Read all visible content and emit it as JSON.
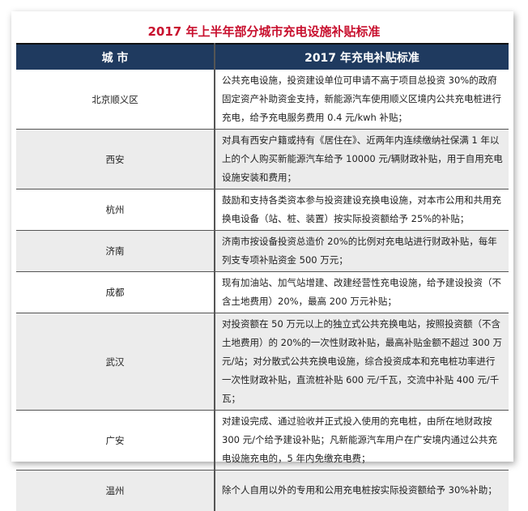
{
  "title": "2017 年上半年部分城市充电设施补贴标准",
  "headers": {
    "city": "城 市",
    "standard": "2017 年充电补贴标准"
  },
  "rows": [
    {
      "city": "北京顺义区",
      "standard": "公共充电设施，投资建设单位可申请不高于项目总投资 30%的政府固定资产补助资金支持，新能源汽车使用顺义区境内公共充电桩进行充电，给予充电服务费用 0.4 元/kwh 补贴；"
    },
    {
      "city": "西安",
      "standard": "对具有西安户籍或持有《居住在》、近两年内连续缴纳社保满 1 年以上的个人购买新能源汽车给予 10000 元/辆财政补贴，用于自用充电设施安装和费用；"
    },
    {
      "city": "杭州",
      "standard": "鼓励和支持各类资本参与投资建设充换电设施，对本市公用和共用充换电设备（站、桩、装置）按实际投资额给予 25%的补贴；"
    },
    {
      "city": "济南",
      "standard": "济南市按设备投资总造价 20%的比例对充电站进行财政补贴，每年列支专项补贴资金 500 万元；"
    },
    {
      "city": "成都",
      "standard": "现有加油站、加气站增建、改建经营性充电设施，给予建设投资（不含土地费用）20%，最高 200 万元补贴；"
    },
    {
      "city": "武汉",
      "standard": "对投资额在 50 万元以上的独立式公共充换电站，按照投资额（不含土地费用）的 20%的一次性财政补贴，最高补贴金额不超过 300 万元/站；对分散式公共充换电设施，综合投资成本和充电桩功率进行一次性财政补贴，直流桩补贴 600 元/千瓦，交流中补贴 400 元/千瓦；"
    },
    {
      "city": "广安",
      "standard": "对建设完成、通过验收并正式投入使用的充电桩，由所在地财政按 300 元/个给予建设补贴；凡新能源汽车用户在广安境内通过公共充电设施充电的，5 年内免缴充电费；"
    },
    {
      "city": "温州",
      "standard": "除个人自用以外的专用和公用充电桩按实际投资额给予 30%补助；"
    }
  ],
  "colors": {
    "title": "#c8102e",
    "header_bg": "#1f3a5f",
    "alt_row": "#ececec"
  }
}
